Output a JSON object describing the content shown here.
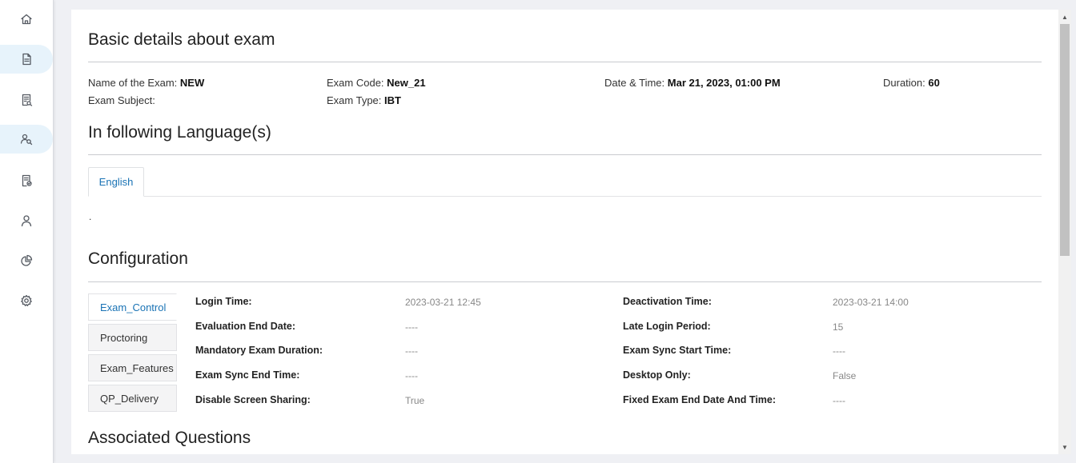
{
  "sidebar": {
    "items": [
      {
        "icon": "home-icon",
        "active": false
      },
      {
        "icon": "document-icon",
        "active": true
      },
      {
        "icon": "report-icon",
        "active": false
      },
      {
        "icon": "search-users-icon",
        "active": true
      },
      {
        "icon": "clipboard-check-icon",
        "active": false
      },
      {
        "icon": "user-icon",
        "active": false
      },
      {
        "icon": "pie-chart-icon",
        "active": false
      },
      {
        "icon": "gear-icon",
        "active": false
      }
    ]
  },
  "basic": {
    "title": "Basic details about exam",
    "name_label": "Name of the Exam:",
    "name_value": "NEW",
    "code_label": "Exam Code:",
    "code_value": "New_21",
    "datetime_label": "Date & Time:",
    "datetime_value": "Mar 21, 2023, 01:00 PM",
    "duration_label": "Duration:",
    "duration_value": "60",
    "subject_label": "Exam Subject:",
    "subject_value": "",
    "type_label": "Exam Type:",
    "type_value": "IBT"
  },
  "languages": {
    "title": "In following Language(s)",
    "tabs": [
      "English"
    ],
    "content": "."
  },
  "config": {
    "title": "Configuration",
    "tabs": [
      "Exam_Control",
      "Proctoring",
      "Exam_Features",
      "QP_Delivery"
    ],
    "rows": [
      {
        "label1": "Login Time:",
        "value1": "2023-03-21 12:45",
        "label2": "Deactivation Time:",
        "value2": "2023-03-21 14:00"
      },
      {
        "label1": "Evaluation End Date:",
        "value1": "----",
        "label2": "Late Login Period:",
        "value2": "15"
      },
      {
        "label1": "Mandatory Exam Duration:",
        "value1": "----",
        "label2": "Exam Sync Start Time:",
        "value2": "----"
      },
      {
        "label1": "Exam Sync End Time:",
        "value1": "----",
        "label2": "Desktop Only:",
        "value2": "False"
      },
      {
        "label1": "Disable Screen Sharing:",
        "value1": "True",
        "label2": "Fixed Exam End Date And Time:",
        "value2": "----"
      }
    ]
  },
  "questions": {
    "title": "Associated Questions"
  },
  "scroll": {
    "up_arrow": "▲",
    "down_arrow": "▼"
  }
}
